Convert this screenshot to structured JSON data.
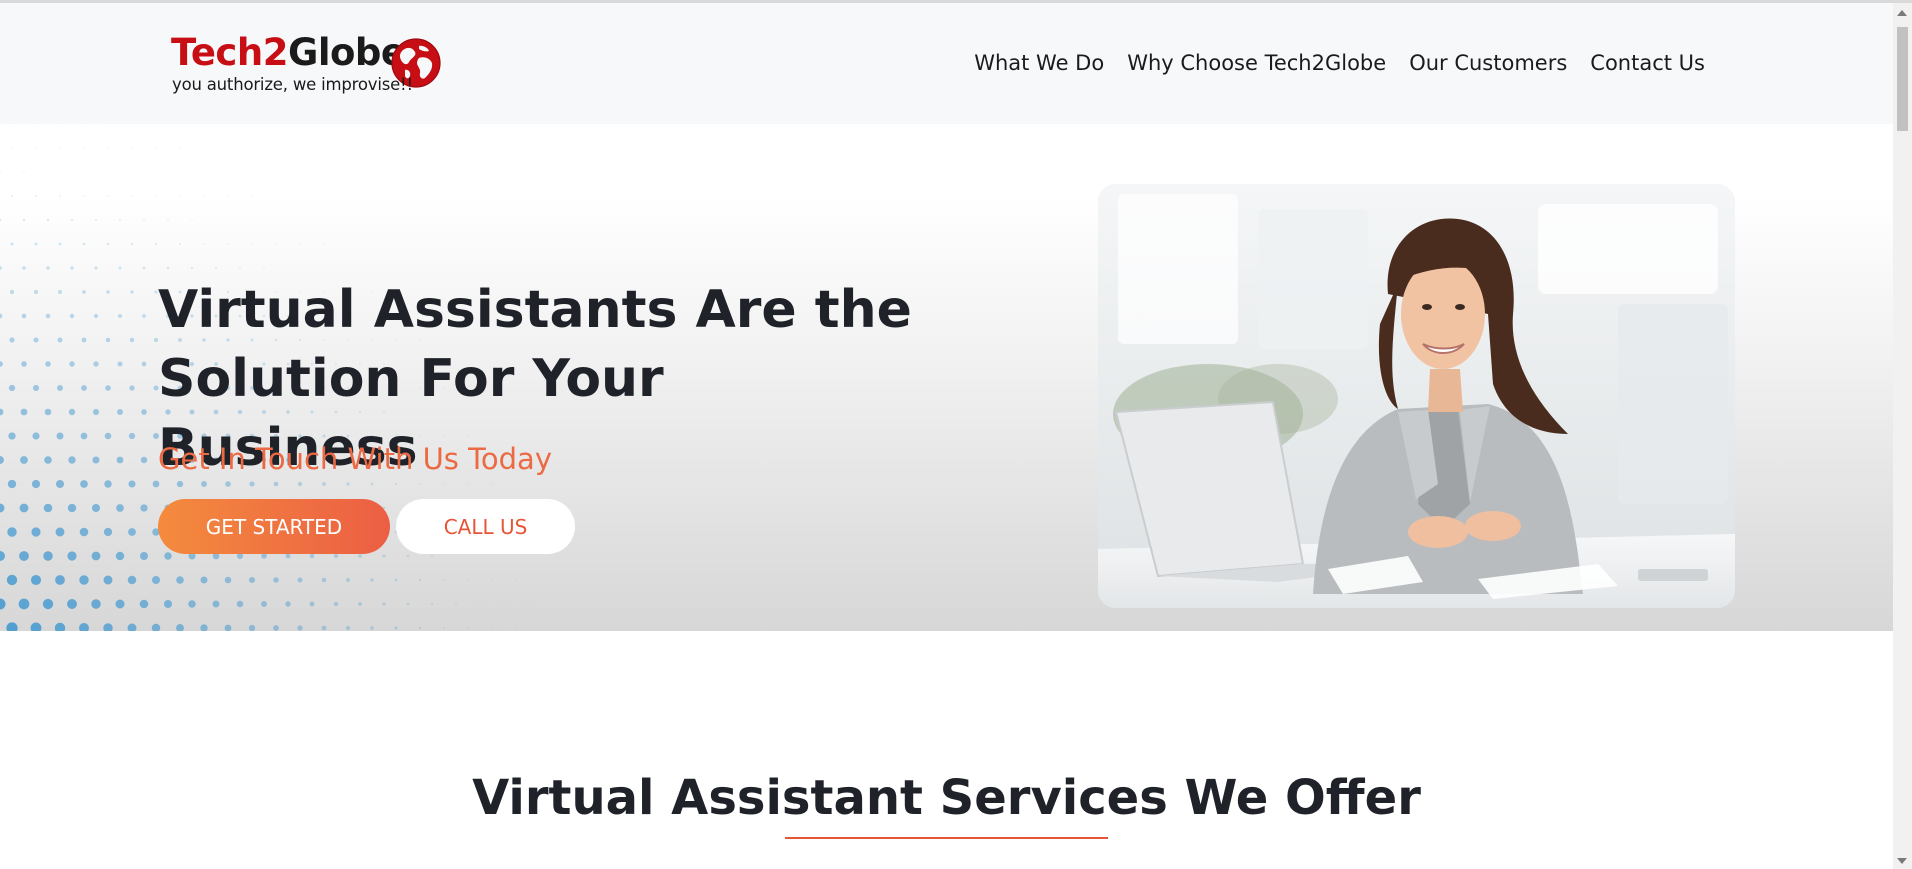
{
  "brand": {
    "name_part1": "Tech",
    "name_part2": "2",
    "name_part3": "Globe",
    "tagline": "you authorize, we improvise!!",
    "colors": {
      "red": "#c80e15",
      "dark": "#1b1b1b"
    }
  },
  "nav": {
    "items": [
      {
        "label": "What We Do"
      },
      {
        "label": "Why Choose Tech2Globe"
      },
      {
        "label": "Our Customers"
      },
      {
        "label": "Contact Us"
      }
    ]
  },
  "hero": {
    "title": "Virtual Assistants Are the Solution For Your Business",
    "subtitle": "Get In Touch With Us Today",
    "primary_button": "GET STARTED",
    "secondary_button": "CALL US",
    "photo_subject": "woman at laptop in office",
    "colors": {
      "accent": "#ec6a43",
      "button_start": "#f48b3d",
      "button_end": "#ec5e44",
      "dots": "#3f97d0"
    }
  },
  "services": {
    "title": "Virtual Assistant Services We Offer",
    "underline_color": "#e55638"
  },
  "icons": {
    "globe": "globe-icon",
    "scroll_up": "scroll-up-arrow-icon",
    "scroll_down": "scroll-down-arrow-icon"
  }
}
